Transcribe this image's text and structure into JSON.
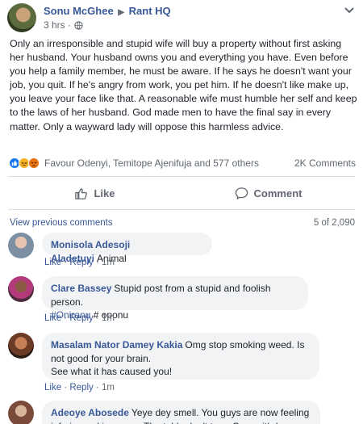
{
  "post": {
    "author": "Sonu McGhee",
    "group": "Rant HQ",
    "time": "3 hrs",
    "dot": "·",
    "text": "Only an irresponsible and stupid wife will buy a property without first asking her husband. Your husband owns you and everything you have. Even before you help a family member, he must be aware. If he says he doesn't want your job, you quit. If he's angry from work, you pet him. If he doesn't like make up, you leave your face like that. A reasonable wife must humble her self and keep to the laws of her husband. God made men to have the final say in every matter. Only a wayward lady will oppose this harmless advice."
  },
  "reactions": {
    "names": "Favour Odenyi, Temitope Ajenifuja and 577 others",
    "comments": "2K Comments",
    "icons": [
      "like-icon",
      "haha-icon",
      "angry-icon"
    ],
    "colors": {
      "like": "#1877f2",
      "haha": "#f7b125",
      "angry": "#e9710f"
    }
  },
  "actions": {
    "like_label": "Like",
    "comment_label": "Comment"
  },
  "comments_section": {
    "view_previous": "View previous comments",
    "counter": "5 of 2,090",
    "items": [
      {
        "name": "Monisola Adesoji Aladetuyi",
        "text": "Animal",
        "like": "Like",
        "reply": "Reply",
        "time": "1m"
      },
      {
        "name": "Clare Bassey",
        "text": "Stupid post from a stupid and foolish person.",
        "tag": "#Oniranu",
        "tag_rest": " # oponu",
        "like": "Like",
        "reply": "Reply",
        "time": "1m"
      },
      {
        "name": "Masalam Nator Damey Kakia",
        "text": "Omg stop smoking weed. Is not good for your brain.",
        "text2": "See what it has caused you!",
        "like": "Like",
        "reply": "Reply",
        "time": "1m"
      },
      {
        "name": "Adeoye Abosede",
        "text": "Yeye dey smell. You guys are now feeling inferior and insecure. The table don't turn, O ya withdraw that"
      }
    ]
  },
  "theme": {
    "link": "#385898",
    "muted": "#606770",
    "bubble": "#f2f3f5"
  }
}
